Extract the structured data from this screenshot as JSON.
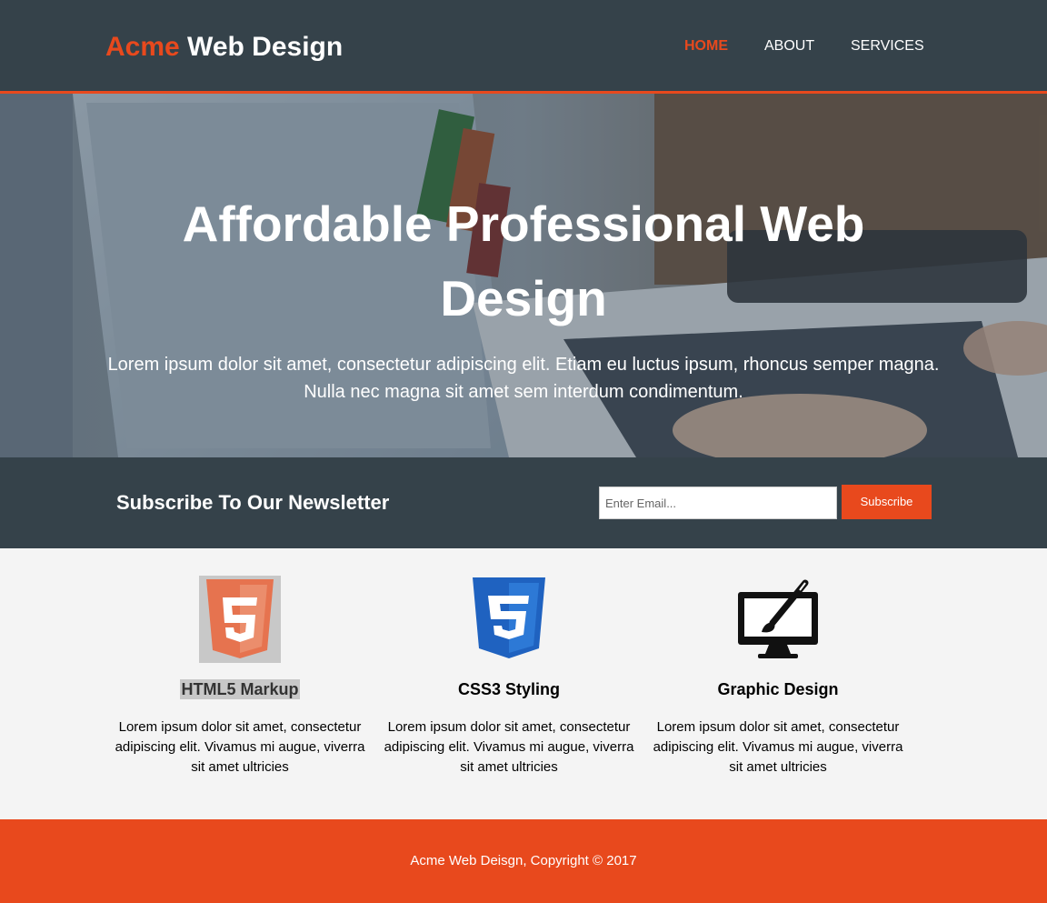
{
  "header": {
    "brand_highlight": "Acme",
    "brand_rest": " Web Design",
    "nav": [
      {
        "label": "Home",
        "active": true
      },
      {
        "label": "About",
        "active": false
      },
      {
        "label": "Services",
        "active": false
      }
    ]
  },
  "showcase": {
    "title": "Affordable Professional Web Design",
    "text": "Lorem ipsum dolor sit amet, consectetur adipiscing elit. Etiam eu luctus ipsum, rhoncus semper magna. Nulla nec magna sit amet sem interdum condimentum."
  },
  "newsletter": {
    "heading": "Subscribe To Our Newsletter",
    "email_placeholder": "Enter Email...",
    "email_value": "",
    "subscribe_label": "Subscribe"
  },
  "boxes": [
    {
      "icon": "html5-icon",
      "title": "HTML5 Markup",
      "text": "Lorem ipsum dolor sit amet, consectetur adipiscing elit. Vivamus mi augue, viverra sit amet ultricies"
    },
    {
      "icon": "css3-icon",
      "title": "CSS3 Styling",
      "text": "Lorem ipsum dolor sit amet, consectetur adipiscing elit. Vivamus mi augue, viverra sit amet ultricies"
    },
    {
      "icon": "graphic-design-monitor-icon",
      "title": "Graphic Design",
      "text": "Lorem ipsum dolor sit amet, consectetur adipiscing elit. Vivamus mi augue, viverra sit amet ultricies"
    }
  ],
  "footer": {
    "text": "Acme Web Deisgn, Copyright © 2017"
  },
  "colors": {
    "accent": "#e8491d",
    "dark": "#35424a",
    "light_bg": "#f4f4f4"
  }
}
